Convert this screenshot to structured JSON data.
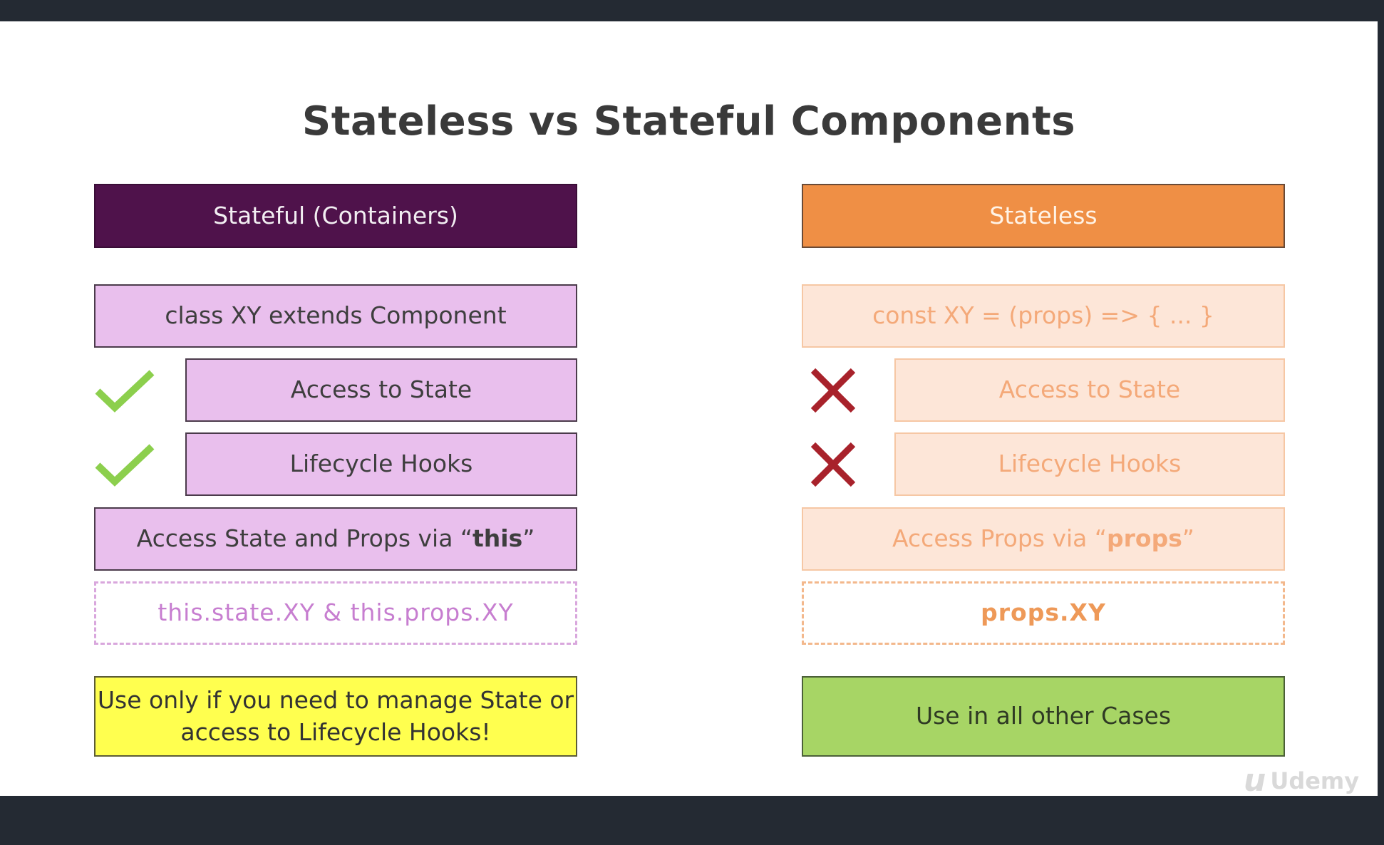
{
  "title": "Stateless vs Stateful Components",
  "left": {
    "header": "Stateful (Containers)",
    "definition": "class XY extends Component",
    "features": [
      {
        "label": "Access to State",
        "status": "check-icon"
      },
      {
        "label": "Lifecycle Hooks",
        "status": "check-icon"
      }
    ],
    "access": {
      "prefix": "Access State and Props via “",
      "keyword": "this",
      "suffix": "”"
    },
    "example": "this.state.XY & this.props.XY",
    "usage": "Use only if you need to manage State or access to Lifecycle Hooks!"
  },
  "right": {
    "header": "Stateless",
    "definition": "const XY = (props) => { ... }",
    "features": [
      {
        "label": "Access to State",
        "status": "cross-icon"
      },
      {
        "label": "Lifecycle Hooks",
        "status": "cross-icon"
      }
    ],
    "access": {
      "prefix": "Access Props via “",
      "keyword": "props",
      "suffix": "”"
    },
    "example": "props.XY",
    "usage": "Use in all other Cases"
  },
  "colors": {
    "stateful_header": "#4f124b",
    "stateless_header": "#ef8f45",
    "stateful_box": "#e9bfed",
    "stateless_box": "#fde6d8",
    "stateful_usage": "#ffff4f",
    "stateless_usage": "#a7d565",
    "check": "#8ccf4d",
    "cross": "#a8222b"
  },
  "watermark": "Udemy"
}
